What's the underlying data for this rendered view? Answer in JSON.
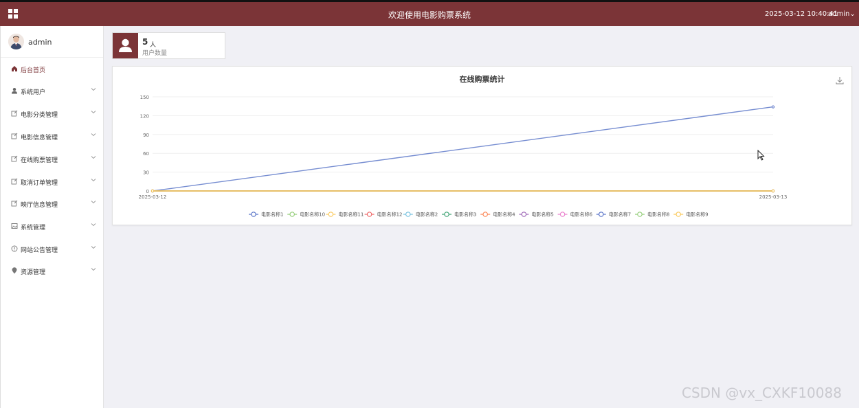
{
  "header": {
    "title": "欢迎使用电影购票系统",
    "datetime": "2025-03-12 10:40:41",
    "user": "admin",
    "user_caret": "⌄"
  },
  "sidebar": {
    "profile_name": "admin",
    "items": [
      {
        "label": "后台首页",
        "icon": "home-icon",
        "active": true
      },
      {
        "label": "系统用户",
        "icon": "user-icon"
      },
      {
        "label": "电影分类管理",
        "icon": "edit-icon"
      },
      {
        "label": "电影信息管理",
        "icon": "edit-icon"
      },
      {
        "label": "在线购票管理",
        "icon": "edit-icon"
      },
      {
        "label": "取消订单管理",
        "icon": "edit-icon"
      },
      {
        "label": "映厅信息管理",
        "icon": "edit-icon"
      },
      {
        "label": "系统管理",
        "icon": "image-icon"
      },
      {
        "label": "网站公告管理",
        "icon": "info-icon"
      },
      {
        "label": "资源管理",
        "icon": "location-icon"
      }
    ]
  },
  "stat": {
    "value": "5",
    "unit": "人",
    "label": "用户数量"
  },
  "chart_data": {
    "type": "line",
    "title": "在线购票统计",
    "x": [
      "2025-03-12",
      "2025-03-13"
    ],
    "yticks": [
      0,
      30,
      60,
      90,
      120,
      150
    ],
    "ylim": [
      0,
      150
    ],
    "grid": true,
    "legend_position": "bottom",
    "series": [
      {
        "name": "电影名称1",
        "values": [
          0,
          0
        ],
        "color": "#5470c6"
      },
      {
        "name": "电影名称10",
        "values": [
          0,
          0
        ],
        "color": "#91cc75"
      },
      {
        "name": "电影名称11",
        "values": [
          0,
          0
        ],
        "color": "#fac858"
      },
      {
        "name": "电影名称12",
        "values": [
          0,
          0
        ],
        "color": "#ee6666"
      },
      {
        "name": "电影名称2",
        "values": [
          0,
          0
        ],
        "color": "#73c0de"
      },
      {
        "name": "电影名称3",
        "values": [
          0,
          0
        ],
        "color": "#3ba272"
      },
      {
        "name": "电影名称4",
        "values": [
          0,
          0
        ],
        "color": "#fc8452"
      },
      {
        "name": "电影名称5",
        "values": [
          0,
          0
        ],
        "color": "#9a60b4"
      },
      {
        "name": "电影名称6",
        "values": [
          0,
          0
        ],
        "color": "#ea7ccc"
      },
      {
        "name": "电影名称7",
        "values": [
          0,
          134
        ],
        "color": "#5470c6"
      },
      {
        "name": "电影名称8",
        "values": [
          0,
          0
        ],
        "color": "#91cc75"
      },
      {
        "name": "电影名称9",
        "values": [
          0,
          0
        ],
        "color": "#fac858"
      }
    ]
  },
  "watermark": "CSDN @vx_CXKF10088",
  "colors": {
    "brand": "#7b3437"
  }
}
